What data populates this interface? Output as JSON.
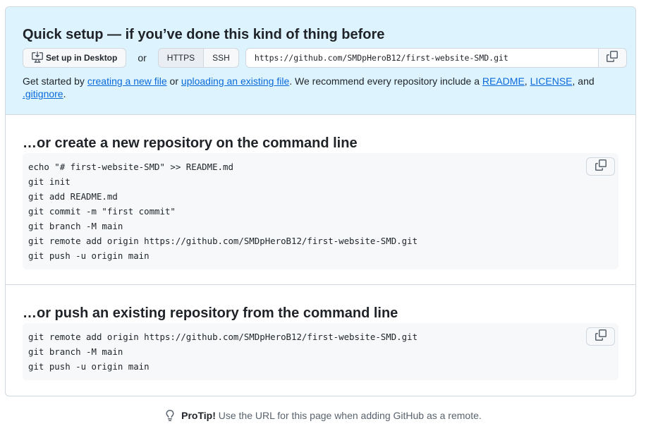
{
  "quick_setup": {
    "title": "Quick setup — if you’ve done this kind of thing before",
    "desktop_button": "Set up in Desktop",
    "or_text": "or",
    "https_label": "HTTPS",
    "ssh_label": "SSH",
    "clone_url": "https://github.com/SMDpHeroB12/first-website-SMD.git",
    "help": {
      "t1": "Get started by ",
      "link_new_file": "creating a new file",
      "t2": " or ",
      "link_upload": "uploading an existing file",
      "t3": ". We recommend every repository include a ",
      "link_readme": "README",
      "t4": ", ",
      "link_license": "LICENSE",
      "t5": ", and ",
      "link_gitignore": ".gitignore",
      "t6": "."
    }
  },
  "new_repo": {
    "title": "…or create a new repository on the command line",
    "code": "echo \"# first-website-SMD\" >> README.md\ngit init\ngit add README.md\ngit commit -m \"first commit\"\ngit branch -M main\ngit remote add origin https://github.com/SMDpHeroB12/first-website-SMD.git\ngit push -u origin main"
  },
  "push_existing": {
    "title": "…or push an existing repository from the command line",
    "code": "git remote add origin https://github.com/SMDpHeroB12/first-website-SMD.git\ngit branch -M main\ngit push -u origin main"
  },
  "protip": {
    "label": "ProTip!",
    "text": " Use the URL for this page when adding GitHub as a remote."
  },
  "icons": {
    "desktop": "desktop-download-icon",
    "copy": "copy-icon",
    "bulb": "light-bulb-icon"
  }
}
